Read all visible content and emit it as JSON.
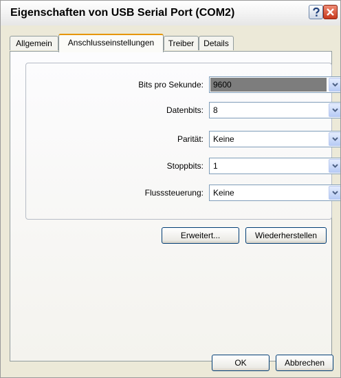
{
  "window": {
    "title": "Eigenschaften von USB Serial Port (COM2)"
  },
  "tabs": [
    {
      "label": "Allgemein"
    },
    {
      "label": "Anschlusseinstellungen"
    },
    {
      "label": "Treiber"
    },
    {
      "label": "Details"
    }
  ],
  "settings": {
    "bits": {
      "label": "Bits pro Sekunde:",
      "value": "9600"
    },
    "databits": {
      "label": "Datenbits:",
      "value": "8"
    },
    "parity": {
      "label": "Parität:",
      "value": "Keine"
    },
    "stopbits": {
      "label": "Stoppbits:",
      "value": "1"
    },
    "flow": {
      "label": "Flusssteuerung:",
      "value": "Keine"
    }
  },
  "buttons": {
    "advanced": "Erweitert...",
    "restore": "Wiederherstellen",
    "ok": "OK",
    "cancel": "Abbrechen"
  },
  "icons": {
    "help": "help-icon",
    "close": "close-icon",
    "dropdown": "chevron-down-icon"
  }
}
